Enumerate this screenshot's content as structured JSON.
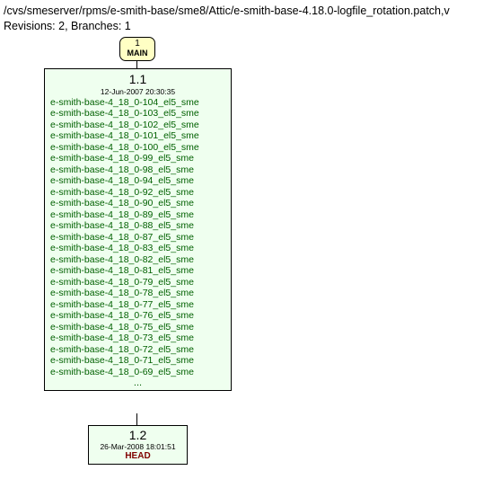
{
  "header": {
    "path": "/cvs/smeserver/rpms/e-smith-base/sme8/Attic/e-smith-base-4.18.0-logfile_rotation.patch,v",
    "stats": "Revisions: 2, Branches: 1"
  },
  "branch": {
    "number": "1",
    "name": "MAIN"
  },
  "rev1": {
    "number": "1.1",
    "date": "12-Jun-2007 20:30:35",
    "tags": [
      "e-smith-base-4_18_0-104_el5_sme",
      "e-smith-base-4_18_0-103_el5_sme",
      "e-smith-base-4_18_0-102_el5_sme",
      "e-smith-base-4_18_0-101_el5_sme",
      "e-smith-base-4_18_0-100_el5_sme",
      "e-smith-base-4_18_0-99_el5_sme",
      "e-smith-base-4_18_0-98_el5_sme",
      "e-smith-base-4_18_0-94_el5_sme",
      "e-smith-base-4_18_0-92_el5_sme",
      "e-smith-base-4_18_0-90_el5_sme",
      "e-smith-base-4_18_0-89_el5_sme",
      "e-smith-base-4_18_0-88_el5_sme",
      "e-smith-base-4_18_0-87_el5_sme",
      "e-smith-base-4_18_0-83_el5_sme",
      "e-smith-base-4_18_0-82_el5_sme",
      "e-smith-base-4_18_0-81_el5_sme",
      "e-smith-base-4_18_0-79_el5_sme",
      "e-smith-base-4_18_0-78_el5_sme",
      "e-smith-base-4_18_0-77_el5_sme",
      "e-smith-base-4_18_0-76_el5_sme",
      "e-smith-base-4_18_0-75_el5_sme",
      "e-smith-base-4_18_0-73_el5_sme",
      "e-smith-base-4_18_0-72_el5_sme",
      "e-smith-base-4_18_0-71_el5_sme",
      "e-smith-base-4_18_0-69_el5_sme"
    ],
    "ellipsis": "..."
  },
  "rev2": {
    "number": "1.2",
    "date": "26-Mar-2008 18:01:51",
    "tag": "HEAD"
  }
}
